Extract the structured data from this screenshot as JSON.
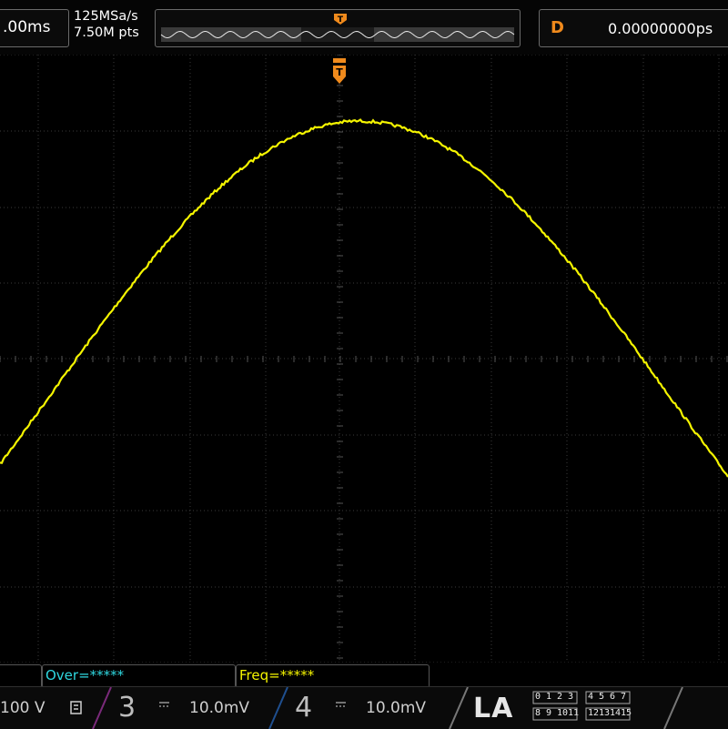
{
  "header": {
    "timebase": ".00ms",
    "sample_rate": "125MSa/s",
    "memory_depth": "7.50M pts",
    "trigger_marker": "T",
    "delay_label": "D",
    "delay_value": "0.00000000ps"
  },
  "screen": {
    "trigger_marker": "T",
    "trace_color": "#f5f500",
    "grid_color": "#3a3a3a"
  },
  "measurements": [
    {
      "label": "Over=*****",
      "color": "#2fd8e0"
    },
    {
      "label": "Freq=*****",
      "color": "#f5f500"
    }
  ],
  "channels": {
    "ch1": {
      "scale": "100 V"
    },
    "ch3": {
      "number": "3",
      "scale": "10.0mV",
      "color": "#c040c0"
    },
    "ch4": {
      "number": "4",
      "scale": "10.0mV",
      "color": "#2f7cd6"
    }
  },
  "logic_analyzer": {
    "label": "LA",
    "bits_row1": [
      "0",
      "1",
      "2",
      "3",
      "4",
      "5",
      "6",
      "7"
    ],
    "bits_row2": [
      "8",
      "9",
      "10",
      "11",
      "12",
      "13",
      "14",
      "15"
    ]
  }
}
